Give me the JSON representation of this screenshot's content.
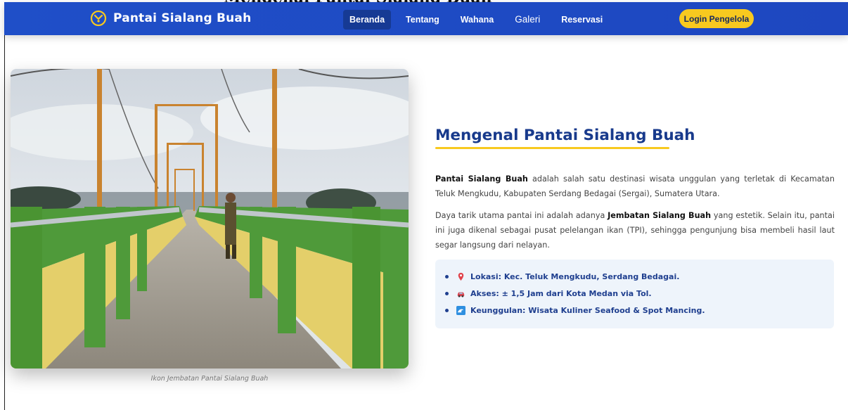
{
  "banner": {
    "text": "Mengenal Pantai Sialang Buah"
  },
  "navbar": {
    "brand": "Pantai Sialang Buah",
    "links": [
      {
        "label": "Beranda",
        "active": true
      },
      {
        "label": "Tentang",
        "active": false
      },
      {
        "label": "Wahana",
        "active": false
      },
      {
        "label": "Galeri",
        "active": false
      },
      {
        "label": "Reservasi",
        "active": false
      }
    ],
    "login_label": "Login Pengelola",
    "colors": {
      "background": "#1f4fc8",
      "active": "#163a94",
      "button": "#f8c91f"
    }
  },
  "hero": {
    "image_alt": "Jembatan Sialang Buah",
    "caption": "Ikon Jembatan Pantai Sialang Buah"
  },
  "about": {
    "title": "Mengenal Pantai Sialang Buah",
    "p1_bold": "Pantai Sialang Buah",
    "p1_rest": " adalah salah satu destinasi wisata unggulan yang terletak di Kecamatan Teluk Mengkudu, Kabupaten Serdang Bedagai (Sergai), Sumatera Utara.",
    "p2_start": "Daya tarik utama pantai ini adalah adanya ",
    "p2_bold": "Jembatan Sialang Buah",
    "p2_rest": " yang estetik. Selain itu, pantai ini juga dikenal sebagai pusat pelelangan ikan (TPI), sehingga pengunjung bisa membeli hasil laut segar langsung dari nelayan.",
    "facts": [
      {
        "icon": "pin-icon",
        "text": "Lokasi: Kec. Teluk Mengkudu, Serdang Bedagai."
      },
      {
        "icon": "car-icon",
        "text": "Akses: ± 1,5 Jam dari Kota Medan via Tol."
      },
      {
        "icon": "wave-icon",
        "text": "Keunggulan: Wisata Kuliner Seafood & Spot Mancing."
      }
    ]
  }
}
